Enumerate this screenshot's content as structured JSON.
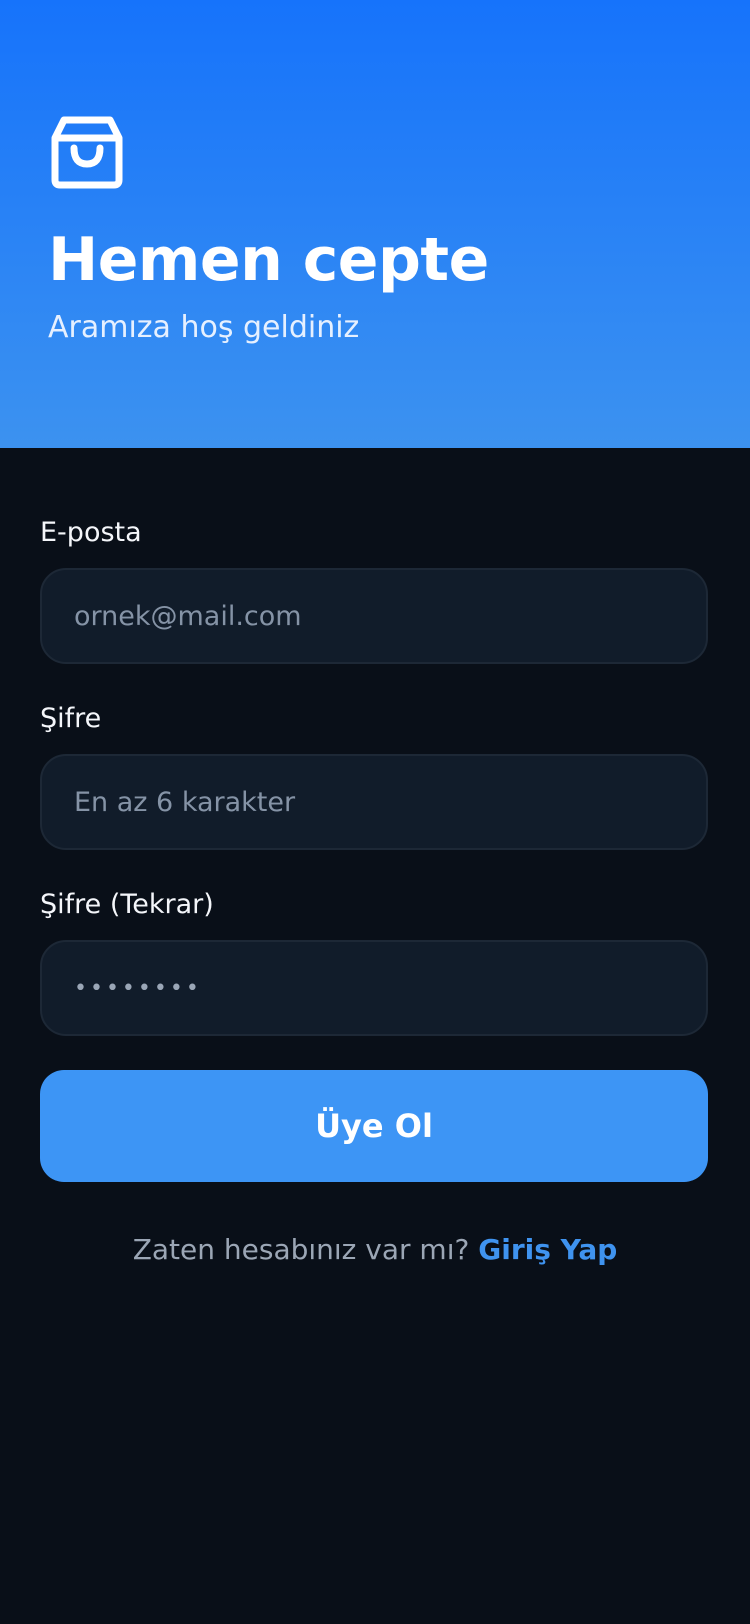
{
  "header": {
    "icon": "shopping-bag-icon",
    "title": "Hemen cepte",
    "subtitle": "Aramıza hoş geldiniz",
    "gradient_top": "#1673fb",
    "gradient_bottom": "#3c92f0"
  },
  "form": {
    "email": {
      "label": "E-posta",
      "placeholder": "ornek@mail.com",
      "value": ""
    },
    "password": {
      "label": "Şifre",
      "placeholder": "En az 6 karakter",
      "value": ""
    },
    "password_confirm": {
      "label": "Şifre (Tekrar)",
      "placeholder": "",
      "value": "••••••••"
    },
    "submit_label": "Üye Ol"
  },
  "footer": {
    "prompt": "Zaten hesabınız var mı?",
    "link_label": "Giriş Yap"
  },
  "colors": {
    "background": "#090f18",
    "input_background": "#111c2a",
    "accent": "#3d95f5"
  }
}
